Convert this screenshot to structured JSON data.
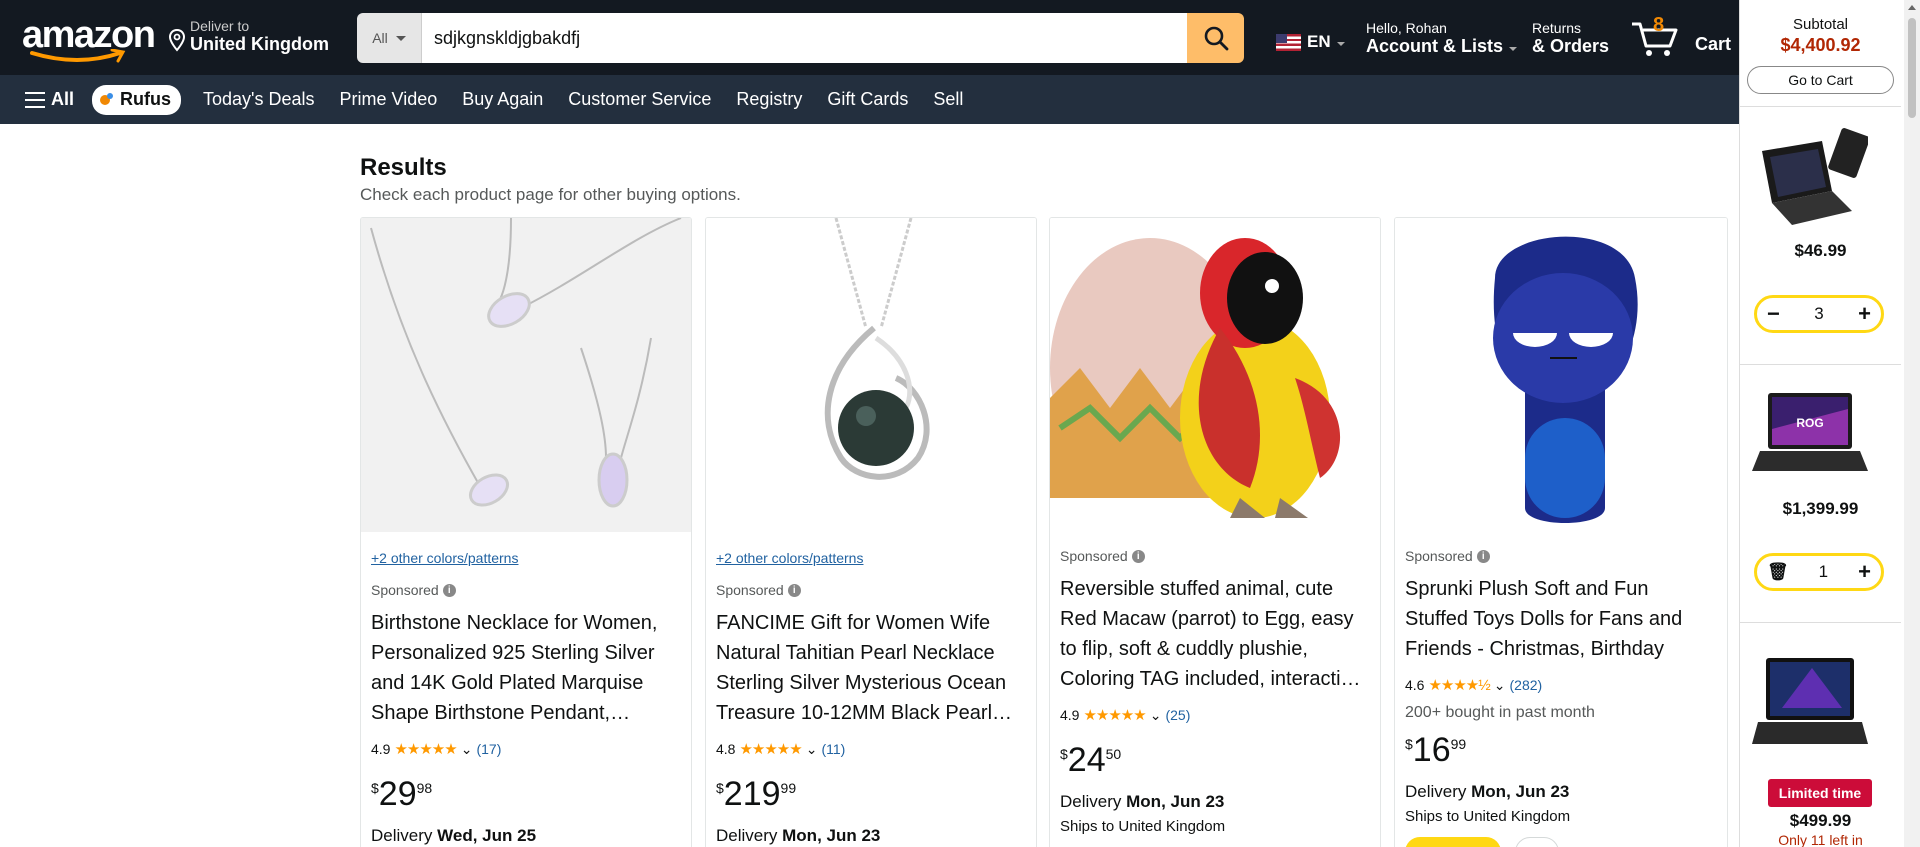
{
  "header": {
    "logo": "amazon",
    "deliver_label": "Deliver to",
    "deliver_location": "United Kingdom",
    "search_category": "All",
    "search_value": "sdjkgnskldjgbakdfj",
    "language": "EN",
    "account_greeting": "Hello, Rohan",
    "account_label": "Account & Lists",
    "returns_label": "Returns",
    "orders_label": "& Orders",
    "cart_count": "8",
    "cart_label": "Cart"
  },
  "subnav": {
    "all_label": "All",
    "rufus_label": "Rufus",
    "links": [
      "Today's Deals",
      "Prime Video",
      "Buy Again",
      "Customer Service",
      "Registry",
      "Gift Cards",
      "Sell"
    ]
  },
  "results": {
    "heading": "Results",
    "subheading": "Check each product page for other buying options."
  },
  "products": [
    {
      "colors_link": "+2 other colors/patterns",
      "sponsored": "Sponsored",
      "title": "Birthstone Necklace for Women, Personalized 925 Sterling Silver and 14K Gold Plated Marquise Shape Birthstone Pendant,…",
      "rating": "4.9",
      "rating_count": "(17)",
      "bought": "",
      "price_symbol": "$",
      "price_whole": "29",
      "price_fraction": "98",
      "delivery_label": "Delivery",
      "delivery_date": "Wed, Jun 25",
      "ships": ""
    },
    {
      "colors_link": "+2 other colors/patterns",
      "sponsored": "Sponsored",
      "title": "FANCIME Gift for Women Wife Natural Tahitian Pearl Necklace Sterling Silver Mysterious Ocean Treasure 10-12MM Black Pearl…",
      "rating": "4.8",
      "rating_count": "(11)",
      "bought": "",
      "price_symbol": "$",
      "price_whole": "219",
      "price_fraction": "99",
      "delivery_label": "Delivery",
      "delivery_date": "Mon, Jun 23",
      "ships": ""
    },
    {
      "colors_link": "",
      "sponsored": "Sponsored",
      "title": "Reversible stuffed animal, cute Red Macaw (parrot) to Egg, easy to flip, soft & cuddly plushie, Coloring TAG included, interacti…",
      "rating": "4.9",
      "rating_count": "(25)",
      "bought": "",
      "price_symbol": "$",
      "price_whole": "24",
      "price_fraction": "50",
      "delivery_label": "Delivery",
      "delivery_date": "Mon, Jun 23",
      "ships": "Ships to United Kingdom"
    },
    {
      "colors_link": "",
      "sponsored": "Sponsored",
      "title": "Sprunki Plush Soft and Fun Stuffed Toys Dolls for Fans and Friends - Christmas, Birthday",
      "rating": "4.6",
      "rating_count": "(282)",
      "bought": "200+ bought in past month",
      "price_symbol": "$",
      "price_whole": "16",
      "price_fraction": "99",
      "delivery_label": "Delivery",
      "delivery_date": "Mon, Jun 23",
      "ships": "Ships to United Kingdom"
    }
  ],
  "cart_panel": {
    "subtotal_label": "Subtotal",
    "subtotal_amount": "$4,400.92",
    "go_to_cart": "Go to Cart",
    "items": [
      {
        "price": "$46.99",
        "quantity": "3"
      },
      {
        "price": "$1,399.99",
        "quantity": "1"
      },
      {
        "badge": "Limited time",
        "price": "$499.99",
        "stock_note": "Only 11 left in"
      }
    ]
  },
  "colors": {
    "nav_bg": "#131921",
    "subnav_bg": "#232f3e",
    "search_button": "#febd69",
    "cart_count": "#f08804",
    "price_red": "#b12704",
    "link_blue": "#2162a1",
    "star": "#ff9900",
    "stepper_border": "#ffd814",
    "limited_badge": "#cc0c39"
  }
}
